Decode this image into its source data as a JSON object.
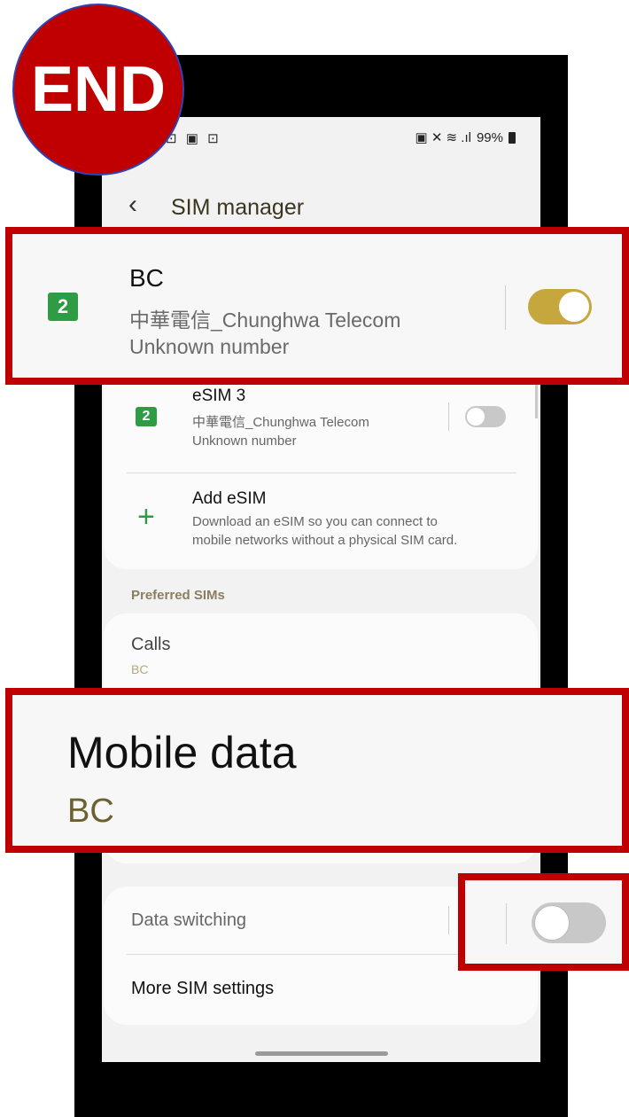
{
  "status_bar": {
    "left_icons": "⊡ ▣ ⊡",
    "right_icons": "▣ ✕ ≋ .ıl",
    "battery": "99%"
  },
  "header": {
    "back_icon": "chevron-left-icon",
    "title": "SIM manager"
  },
  "sims": [
    {
      "name": "BC",
      "carrier": "中華電信_Chunghwa Telecom",
      "number": "Unknown number",
      "slot": "2",
      "enabled": true
    },
    {
      "name": "eSIM 3",
      "carrier": "中華電信_Chunghwa Telecom",
      "number": "Unknown number",
      "slot": "2",
      "enabled": false
    }
  ],
  "add_esim": {
    "title": "Add eSIM",
    "description_line1": "Download an eSIM so you can connect to",
    "description_line2": "mobile networks without a physical SIM card."
  },
  "preferred": {
    "section_label": "Preferred SIMs",
    "calls": {
      "label": "Calls",
      "value": "BC"
    },
    "mobile_data": {
      "label": "Mobile data",
      "value": "BC"
    }
  },
  "data_switching": {
    "label": "Data switching",
    "enabled": false
  },
  "more_settings": "More SIM settings",
  "end_badge": "END",
  "colors": {
    "highlight": "#c00000",
    "toggle_on": "#c5a73d",
    "sim_green": "#2e9b45"
  }
}
